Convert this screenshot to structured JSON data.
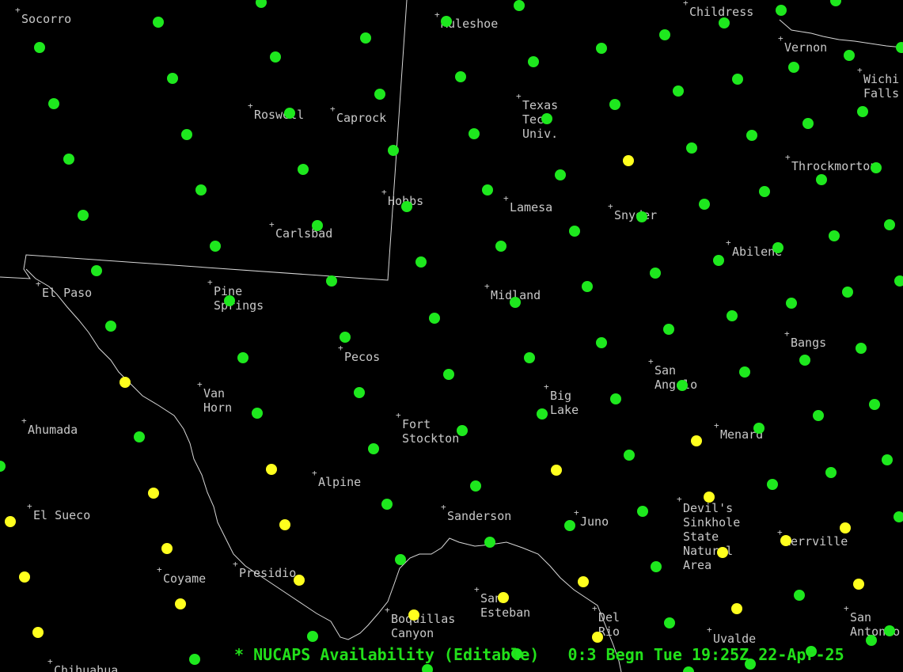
{
  "colors": {
    "background": "#000000",
    "boundary": "#d8d8d8",
    "label": "#c8c8c8",
    "available": "#1ee81e",
    "pending": "#ffff1e",
    "status_text": "#22e01a"
  },
  "status": {
    "legend": "* NUCAPS Availability (Editable)",
    "frame": "0:3",
    "time_text": "Begn Tue 19:25Z 22-Apr-25"
  },
  "cities": [
    {
      "name": [
        "Socorro"
      ]
    },
    {
      "name": [
        "Muleshoe"
      ]
    },
    {
      "name": [
        "Childress"
      ]
    },
    {
      "name": [
        "Vernon"
      ]
    },
    {
      "name": [
        "Wichi",
        "Falls"
      ]
    },
    {
      "name": [
        "Texas",
        "Tech",
        "Univ."
      ]
    },
    {
      "name": [
        "Roswell"
      ]
    },
    {
      "name": [
        "Caprock"
      ]
    },
    {
      "name": [
        "Throckmorton"
      ]
    },
    {
      "name": [
        "Hobbs"
      ]
    },
    {
      "name": [
        "Lamesa"
      ]
    },
    {
      "name": [
        "Snyder"
      ]
    },
    {
      "name": [
        "Carlsbad"
      ]
    },
    {
      "name": [
        "Abilene"
      ]
    },
    {
      "name": [
        "El Paso"
      ]
    },
    {
      "name": [
        "Pine",
        "Springs"
      ]
    },
    {
      "name": [
        "Midland"
      ]
    },
    {
      "name": [
        "Bangs"
      ]
    },
    {
      "name": [
        "Pecos"
      ]
    },
    {
      "name": [
        "San",
        "Angelo"
      ]
    },
    {
      "name": [
        "Van",
        "Horn"
      ]
    },
    {
      "name": [
        "Big",
        "Lake"
      ]
    },
    {
      "name": [
        "Fort",
        "Stockton"
      ]
    },
    {
      "name": [
        "Ahumada"
      ]
    },
    {
      "name": [
        "Menard"
      ]
    },
    {
      "name": [
        "Alpine"
      ]
    },
    {
      "name": [
        "Devil's",
        "Sinkhole",
        "State",
        "Natural",
        "Area"
      ]
    },
    {
      "name": [
        "El Sueco"
      ]
    },
    {
      "name": [
        "Sanderson"
      ]
    },
    {
      "name": [
        "Juno"
      ]
    },
    {
      "name": [
        "Kerrville"
      ]
    },
    {
      "name": [
        "Coyame"
      ]
    },
    {
      "name": [
        "Presidio"
      ]
    },
    {
      "name": [
        "San",
        "Esteban"
      ]
    },
    {
      "name": [
        "Del",
        "Rio"
      ]
    },
    {
      "name": [
        "San",
        "Antonio"
      ]
    },
    {
      "name": [
        "Boquillas",
        "Canyon"
      ]
    },
    {
      "name": [
        "Uvalde"
      ]
    },
    {
      "name": [
        "Chihuahua"
      ]
    }
  ],
  "sounding_points": [
    {
      "status": "available"
    },
    {
      "status": "available"
    },
    {
      "status": "available"
    },
    {
      "status": "available"
    },
    {
      "status": "available"
    },
    {
      "status": "available"
    },
    {
      "status": "available"
    },
    {
      "status": "available"
    },
    {
      "status": "available"
    },
    {
      "status": "available"
    },
    {
      "status": "available"
    },
    {
      "status": "available"
    },
    {
      "status": "available"
    },
    {
      "status": "available"
    },
    {
      "status": "available"
    },
    {
      "status": "available"
    },
    {
      "status": "available"
    },
    {
      "status": "available"
    },
    {
      "status": "available"
    },
    {
      "status": "available"
    },
    {
      "status": "available"
    },
    {
      "status": "available"
    },
    {
      "status": "available"
    },
    {
      "status": "available"
    },
    {
      "status": "available"
    },
    {
      "status": "available"
    },
    {
      "status": "available"
    },
    {
      "status": "available"
    },
    {
      "status": "available"
    },
    {
      "status": "available"
    },
    {
      "status": "available"
    },
    {
      "status": "available"
    },
    {
      "status": "pending"
    },
    {
      "status": "available"
    },
    {
      "status": "available"
    },
    {
      "status": "available"
    },
    {
      "status": "available"
    },
    {
      "status": "available"
    },
    {
      "status": "available"
    },
    {
      "status": "available"
    },
    {
      "status": "available"
    },
    {
      "status": "available"
    },
    {
      "status": "available"
    },
    {
      "status": "available"
    },
    {
      "status": "available"
    },
    {
      "status": "available"
    },
    {
      "status": "available"
    },
    {
      "status": "available"
    },
    {
      "status": "available"
    },
    {
      "status": "available"
    },
    {
      "status": "available"
    },
    {
      "status": "available"
    },
    {
      "status": "available"
    },
    {
      "status": "available"
    },
    {
      "status": "available"
    },
    {
      "status": "available"
    },
    {
      "status": "available"
    },
    {
      "status": "available"
    },
    {
      "status": "available"
    },
    {
      "status": "available"
    },
    {
      "status": "available"
    },
    {
      "status": "available"
    },
    {
      "status": "available"
    },
    {
      "status": "available"
    },
    {
      "status": "available"
    },
    {
      "status": "available"
    },
    {
      "status": "available"
    },
    {
      "status": "available"
    },
    {
      "status": "available"
    },
    {
      "status": "available"
    },
    {
      "status": "available"
    },
    {
      "status": "available"
    },
    {
      "status": "available"
    },
    {
      "status": "available"
    },
    {
      "status": "available"
    },
    {
      "status": "pending"
    },
    {
      "status": "available"
    },
    {
      "status": "available"
    },
    {
      "status": "available"
    },
    {
      "status": "available"
    },
    {
      "status": "available"
    },
    {
      "status": "available"
    },
    {
      "status": "available"
    },
    {
      "status": "available"
    },
    {
      "status": "pending"
    },
    {
      "status": "available"
    },
    {
      "status": "available"
    },
    {
      "status": "available"
    },
    {
      "status": "available"
    },
    {
      "status": "available"
    },
    {
      "status": "available"
    },
    {
      "status": "pending"
    },
    {
      "status": "pending"
    },
    {
      "status": "available"
    },
    {
      "status": "available"
    },
    {
      "status": "pending"
    },
    {
      "status": "pending"
    },
    {
      "status": "available"
    },
    {
      "status": "available"
    },
    {
      "status": "available"
    },
    {
      "status": "pending"
    },
    {
      "status": "available"
    },
    {
      "status": "pending"
    },
    {
      "status": "pending"
    },
    {
      "status": "pending"
    },
    {
      "status": "pending"
    },
    {
      "status": "pending"
    },
    {
      "status": "available"
    },
    {
      "status": "available"
    },
    {
      "status": "available"
    },
    {
      "status": "pending"
    },
    {
      "status": "pending"
    },
    {
      "status": "pending"
    },
    {
      "status": "pending"
    },
    {
      "status": "pending"
    },
    {
      "status": "available"
    },
    {
      "status": "pending"
    },
    {
      "status": "pending"
    },
    {
      "status": "available"
    },
    {
      "status": "pending"
    },
    {
      "status": "pending"
    },
    {
      "status": "pending"
    },
    {
      "status": "available"
    },
    {
      "status": "available"
    },
    {
      "status": "available"
    },
    {
      "status": "available"
    },
    {
      "status": "available"
    },
    {
      "status": "available"
    },
    {
      "status": "available"
    },
    {
      "status": "available"
    },
    {
      "status": "available"
    },
    {
      "status": "available"
    },
    {
      "status": "available"
    },
    {
      "status": "available"
    },
    {
      "status": "available"
    },
    {
      "status": "available"
    }
  ]
}
